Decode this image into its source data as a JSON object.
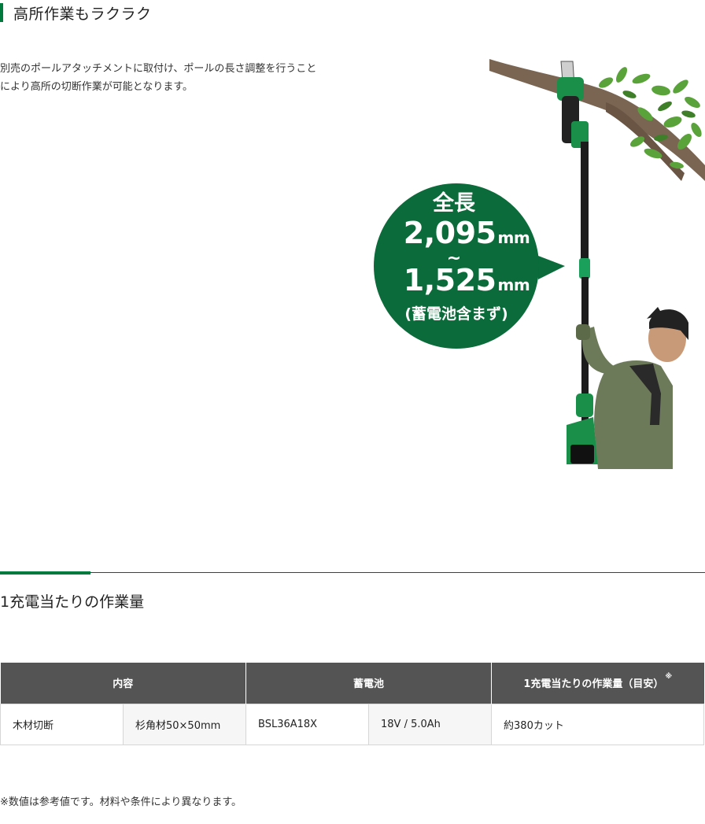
{
  "section1": {
    "title": "高所作業もラクラク",
    "description_line1": "別売のポールアタッチメントに取付け、ポールの長さ調整を行うこと",
    "description_line2": "により高所の切断作業が可能となります。"
  },
  "callout": {
    "label": "全長",
    "max_value": "2,095",
    "min_value": "1,525",
    "unit": "mm",
    "separator": "~",
    "note": "(蓄電池含まず)"
  },
  "section2": {
    "title": "1充電当たりの作業量"
  },
  "table": {
    "headers": [
      "内容",
      "蓄電池",
      "1充電当たりの作業量（目安）"
    ],
    "header_note_mark": "※",
    "row": [
      "木材切断",
      "杉角材50×50mm",
      "BSL36A18X",
      "18V / 5.0Ah",
      "約380カット"
    ]
  },
  "footnote": "※数値は参考値です。材料や条件により異なります。",
  "colors": {
    "accent_green": "#007a3d",
    "callout_green": "#0b6b3a",
    "table_header": "#545454"
  }
}
